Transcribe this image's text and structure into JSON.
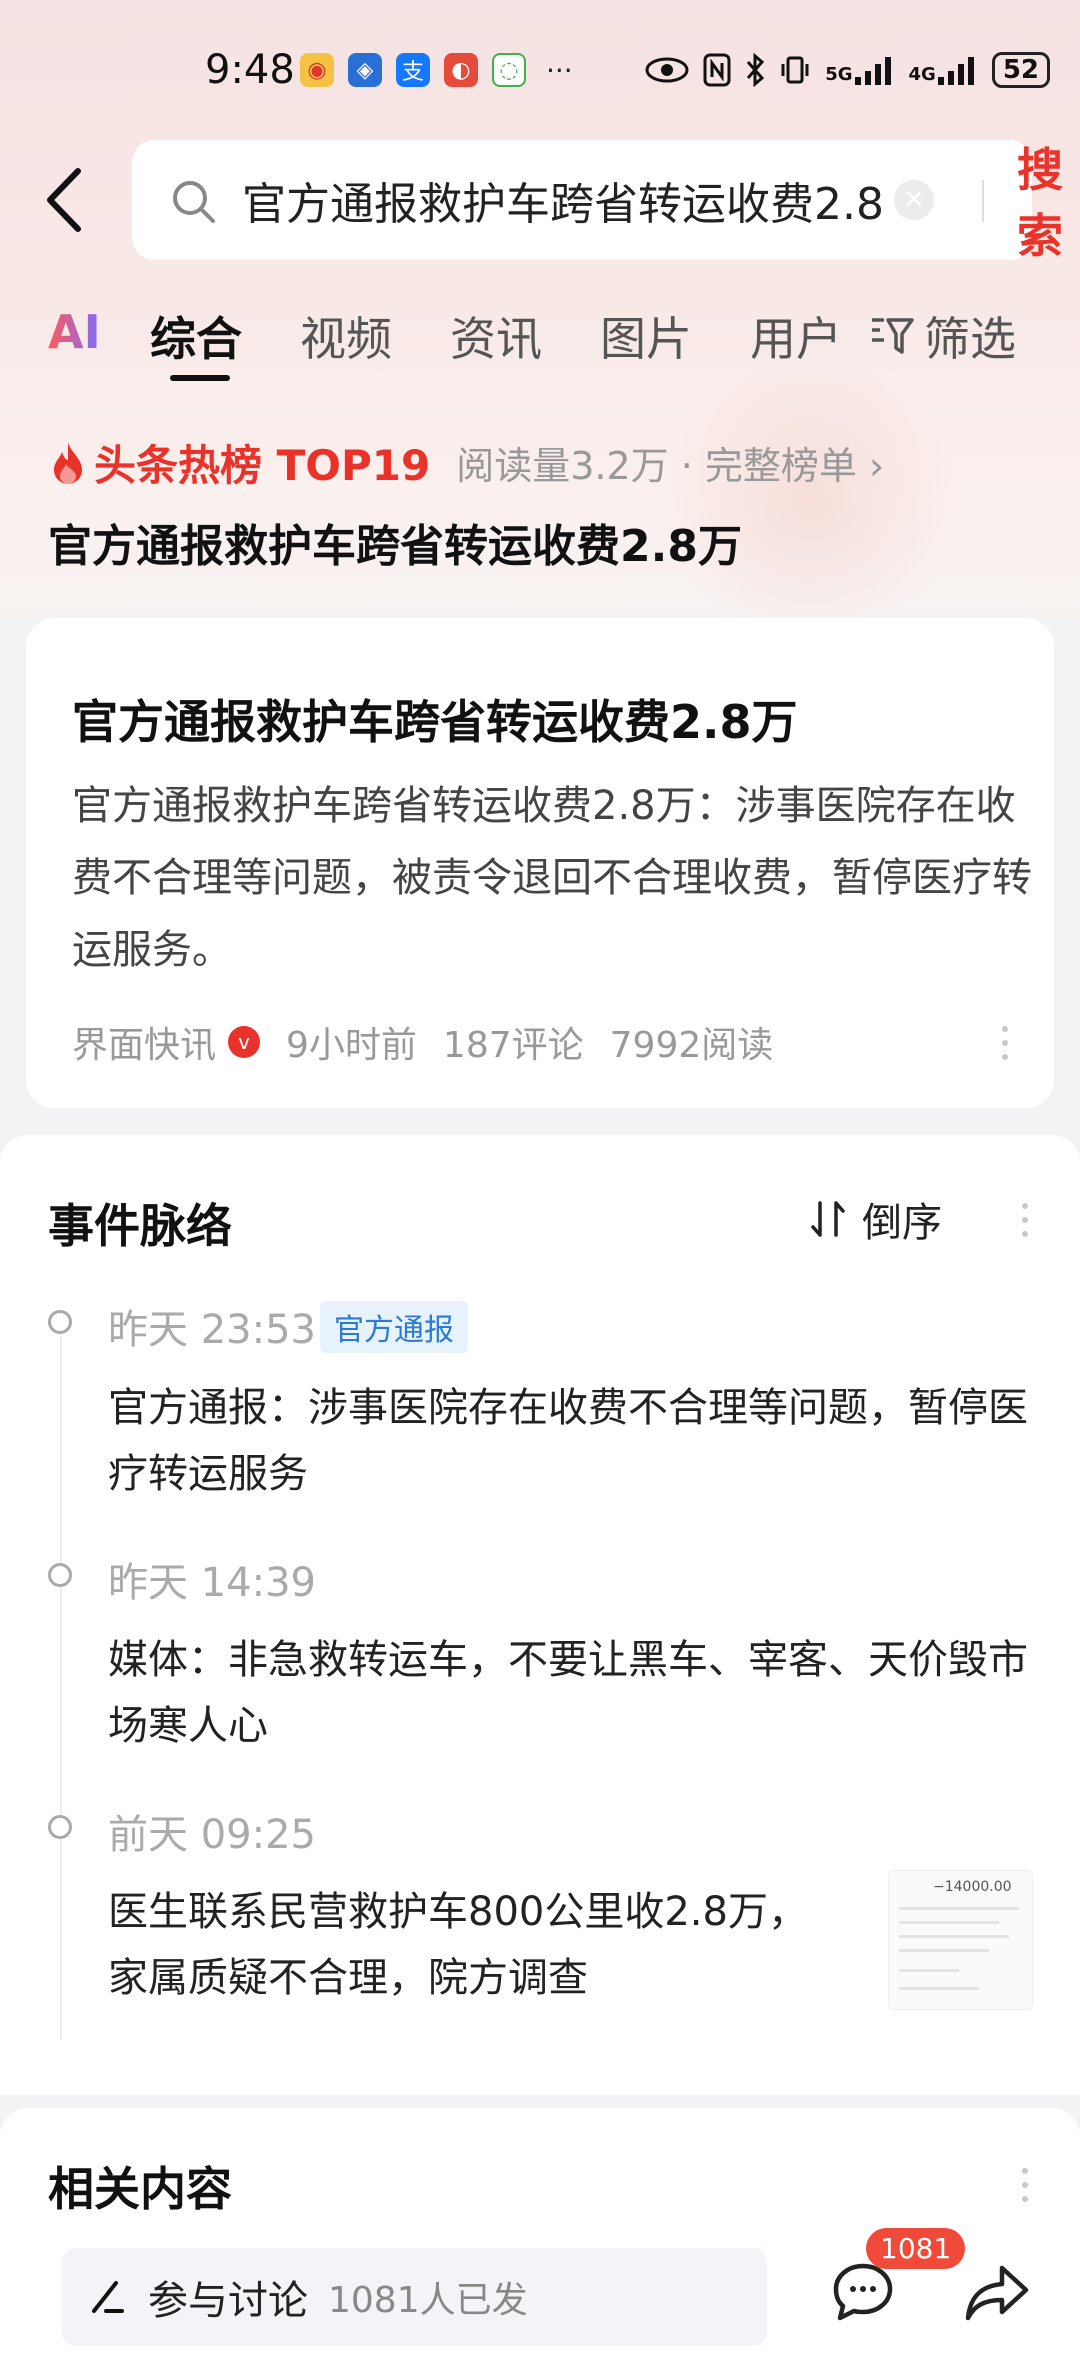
{
  "status_bar": {
    "time": "9:48",
    "network_5g": "5G",
    "network_4g": "4G",
    "battery": "52"
  },
  "search": {
    "query": "官方通报救护车跨省转运收费2.8万",
    "button_label": "搜索"
  },
  "tabs": [
    {
      "label": "AI"
    },
    {
      "label": "综合"
    },
    {
      "label": "视频"
    },
    {
      "label": "资讯"
    },
    {
      "label": "图片"
    },
    {
      "label": "用户"
    }
  ],
  "filter_label": "筛选",
  "hot_rank": {
    "label": "头条热榜 TOP19",
    "meta": "阅读量3.2万 · 完整榜单 ›",
    "title": "官方通报救护车跨省转运收费2.8万"
  },
  "news_card": {
    "title": "官方通报救护车跨省转运收费2.8万",
    "body": "官方通报救护车跨省转运收费2.8万：涉事医院存在收费不合理等问题，被责令退回不合理收费，暂停医疗转运服务。",
    "source": "界面快讯",
    "time": "9小时前",
    "comments": "187评论",
    "reads": "7992阅读"
  },
  "timeline": {
    "title": "事件脉络",
    "sort_label": "倒序",
    "events": [
      {
        "time": "昨天 23:53",
        "tag": "官方通报",
        "text": "官方通报：涉事医院存在收费不合理等问题，暂停医疗转运服务"
      },
      {
        "time": "昨天 14:39",
        "text": "媒体：非急救转运车，不要让黑车、宰客、天价毁市场寒人心"
      },
      {
        "time": "前天 09:25",
        "text": "医生联系民营救护车800公里收2.8万，家属质疑不合理，院方调查"
      }
    ],
    "thumbnail_amount": "−14000.00"
  },
  "related": {
    "title": "相关内容",
    "discuss_label": "参与讨论",
    "discuss_count": "1081人已发",
    "comment_badge": "1081"
  },
  "colors": {
    "accent": "#e8322a",
    "tag_blue": "#2a7bd5"
  }
}
